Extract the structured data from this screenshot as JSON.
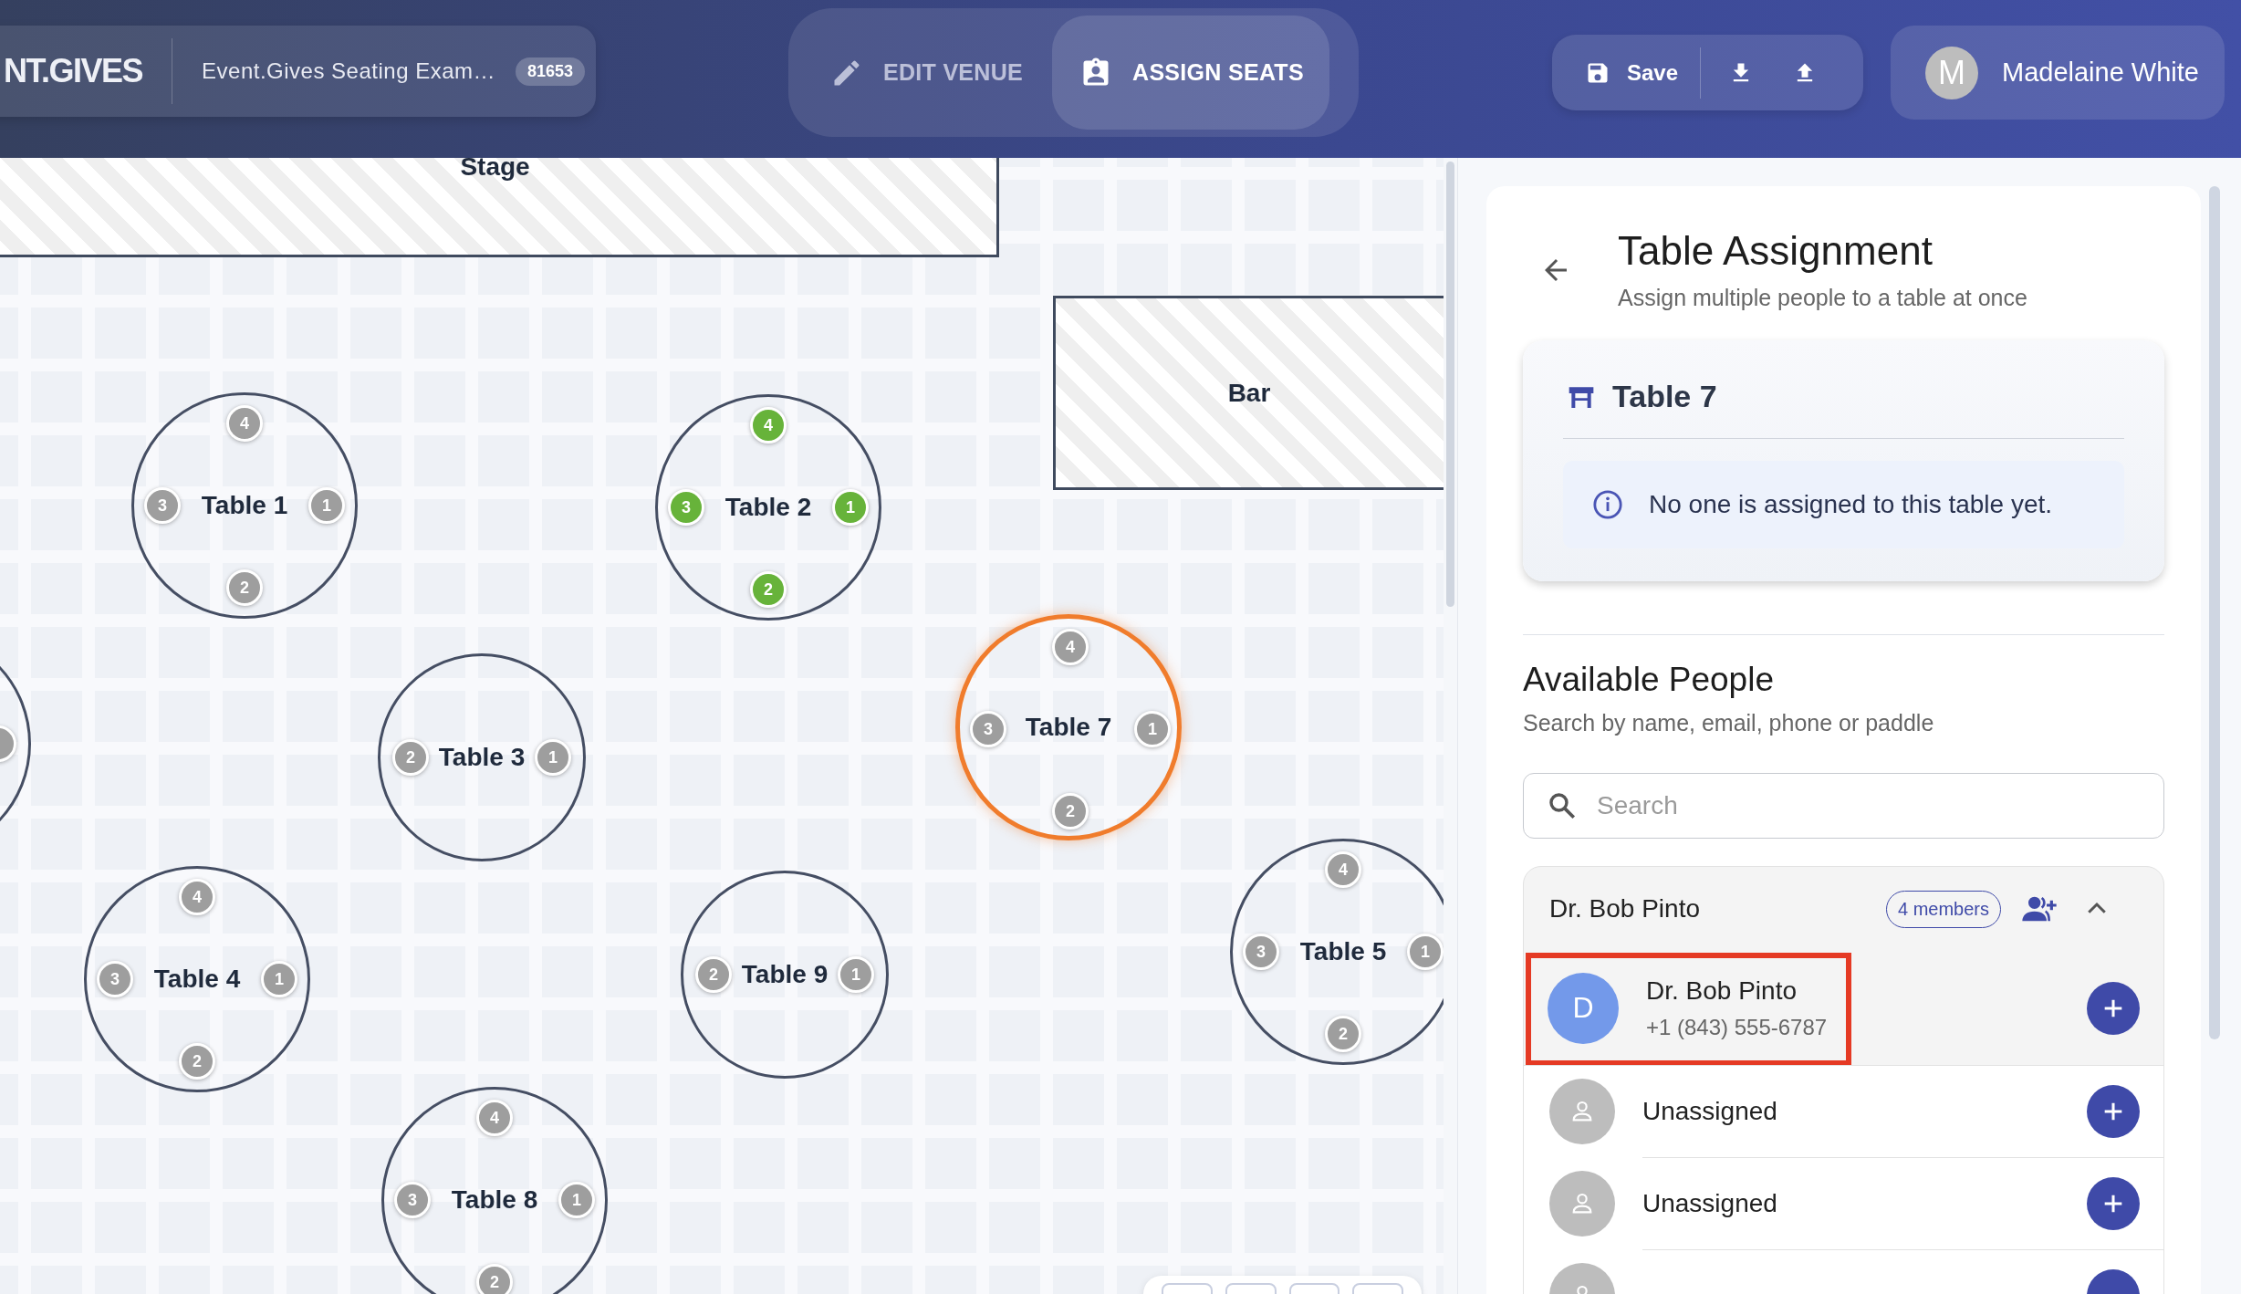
{
  "header": {
    "logo": "NT.GIVES",
    "event_title": "Event.Gives Seating Exam…",
    "event_id": "81653",
    "modes": [
      {
        "label": "EDIT VENUE",
        "selected": false
      },
      {
        "label": "ASSIGN SEATS",
        "selected": true
      }
    ],
    "save_label": "Save",
    "user": {
      "initial": "M",
      "name": "Madelaine White"
    }
  },
  "canvas": {
    "areas": [
      {
        "label": "Stage"
      },
      {
        "label": "Bar"
      }
    ],
    "tables": [
      {
        "name": "Table 1",
        "selected": false,
        "seats": [
          {
            "label": "4",
            "assigned": false
          },
          {
            "label": "3",
            "assigned": false
          },
          {
            "label": "1",
            "assigned": false
          },
          {
            "label": "2",
            "assigned": false
          }
        ]
      },
      {
        "name": "Table 2",
        "selected": false,
        "seats": [
          {
            "label": "4",
            "assigned": true
          },
          {
            "label": "3",
            "assigned": true
          },
          {
            "label": "1",
            "assigned": true
          },
          {
            "label": "2",
            "assigned": true
          }
        ]
      },
      {
        "name": "Table 3",
        "selected": false,
        "seats": [
          {
            "label": "2",
            "assigned": false
          },
          {
            "label": "1",
            "assigned": false
          }
        ]
      },
      {
        "name": "Table 7",
        "selected": true,
        "seats": [
          {
            "label": "4",
            "assigned": false
          },
          {
            "label": "3",
            "assigned": false
          },
          {
            "label": "1",
            "assigned": false
          },
          {
            "label": "2",
            "assigned": false
          }
        ]
      },
      {
        "name": "Table 4",
        "selected": false,
        "seats": [
          {
            "label": "4",
            "assigned": false
          },
          {
            "label": "3",
            "assigned": false
          },
          {
            "label": "1",
            "assigned": false
          },
          {
            "label": "2",
            "assigned": false
          }
        ]
      },
      {
        "name": "Table 9",
        "selected": false,
        "seats": [
          {
            "label": "2",
            "assigned": false
          },
          {
            "label": "1",
            "assigned": false
          }
        ]
      },
      {
        "name": "Table 5",
        "selected": false,
        "seats": [
          {
            "label": "4",
            "assigned": false
          },
          {
            "label": "3",
            "assigned": false
          },
          {
            "label": "1",
            "assigned": false
          },
          {
            "label": "2",
            "assigned": false
          }
        ]
      },
      {
        "name": "Table 8",
        "selected": false,
        "seats": [
          {
            "label": "4",
            "assigned": false
          },
          {
            "label": "3",
            "assigned": false
          },
          {
            "label": "1",
            "assigned": false
          },
          {
            "label": "2",
            "assigned": false
          }
        ]
      }
    ]
  },
  "panel": {
    "title": "Table Assignment",
    "subtitle": "Assign multiple people to a table at once",
    "table_card": {
      "name": "Table 7",
      "message": "No one is assigned to this table yet."
    },
    "people_title": "Available People",
    "people_subtitle": "Search by name, email, phone or paddle",
    "search": {
      "placeholder": "Search"
    },
    "group": {
      "name": "Dr. Bob Pinto",
      "badge": "4 members",
      "expanded": true,
      "members": [
        {
          "kind": "person",
          "initial": "D",
          "name": "Dr. Bob Pinto",
          "phone": "+1 (843) 555-6787",
          "highlighted": true
        },
        {
          "kind": "unassigned",
          "name": "Unassigned",
          "highlighted": false
        },
        {
          "kind": "unassigned",
          "name": "Unassigned",
          "highlighted": false
        },
        {
          "kind": "unassigned",
          "highlighted": false
        }
      ]
    }
  }
}
